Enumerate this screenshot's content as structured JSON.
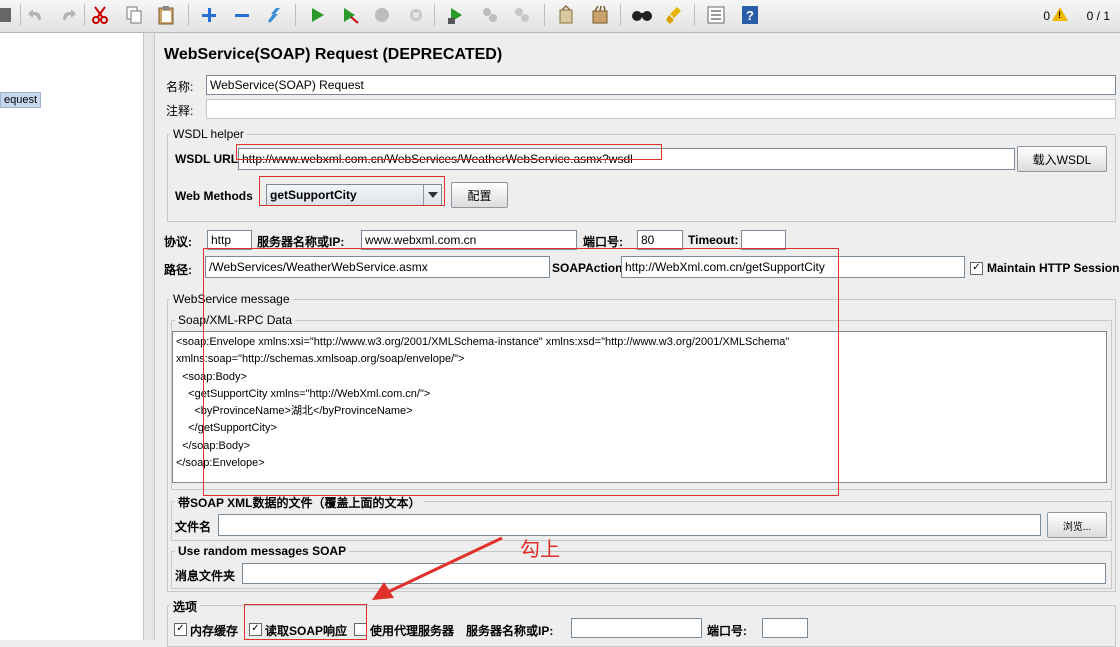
{
  "toolbar": {
    "icons": [
      "templates-icon",
      "undo-icon",
      "redo-icon",
      "cut-icon",
      "copy-icon",
      "paste-icon",
      "expand-icon",
      "collapse-icon",
      "toggle-icon",
      "start-icon",
      "start-no-pause-icon",
      "stop-icon",
      "shutdown-icon",
      "remote-start-icon",
      "remote-stop-icon",
      "remote-shutdown-icon",
      "clear-icon",
      "clear-all-icon",
      "search-icon",
      "reset-search-icon",
      "function-helper-icon",
      "help-icon"
    ],
    "error_count": "0",
    "thread_count": "0 / 1"
  },
  "tree": {
    "selected_item": "equest"
  },
  "page_title": "WebService(SOAP) Request (DEPRECATED)",
  "name_label": "名称:",
  "name_value": "WebService(SOAP) Request",
  "comment_label": "注释:",
  "wsdl": {
    "legend": "WSDL helper",
    "url_label": "WSDL URL",
    "url_value": "http://www.webxml.com.cn/WebServices/WeatherWebService.asmx?wsdl",
    "load_button": "载入WSDL",
    "methods_label": "Web Methods",
    "method_selected": "getSupportCity",
    "configure_button": "配置"
  },
  "conn": {
    "protocol_label": "协议:",
    "protocol_value": "http",
    "server_label": "服务器名称或IP:",
    "server_value": "www.webxml.com.cn",
    "port_label": "端口号:",
    "port_value": "80",
    "timeout_label": "Timeout:",
    "path_label": "路径:",
    "path_value": "/WebServices/WeatherWebService.asmx",
    "soapaction_label": "SOAPAction",
    "soapaction_value": "http://WebXml.com.cn/getSupportCity",
    "maintain_session_label": "Maintain HTTP Session"
  },
  "message": {
    "legend": "WebService message",
    "data_legend": "Soap/XML-RPC Data",
    "xml": "<soap:Envelope xmlns:xsi=\"http://www.w3.org/2001/XMLSchema-instance\" xmlns:xsd=\"http://www.w3.org/2001/XMLSchema\"\nxmlns:soap=\"http://schemas.xmlsoap.org/soap/envelope/\">\n  <soap:Body>\n    <getSupportCity xmlns=\"http://WebXml.com.cn/\">\n      <byProvinceName>湖北</byProvinceName>\n    </getSupportCity>\n  </soap:Body>\n</soap:Envelope>",
    "file_legend": "带SOAP XML数据的文件（覆盖上面的文本）",
    "file_label": "文件名",
    "browse_button": "浏览...",
    "random_legend": "Use random messages SOAP",
    "folder_label": "消息文件夹"
  },
  "options": {
    "legend": "选项",
    "memory_cache_label": "内存缓存",
    "read_response_label": "读取SOAP响应",
    "use_proxy_label": "使用代理服务器",
    "proxy_server_label": "服务器名称或IP:",
    "proxy_port_label": "端口号:"
  },
  "annotation": {
    "text": "勾上",
    "color": "#e0302a"
  }
}
